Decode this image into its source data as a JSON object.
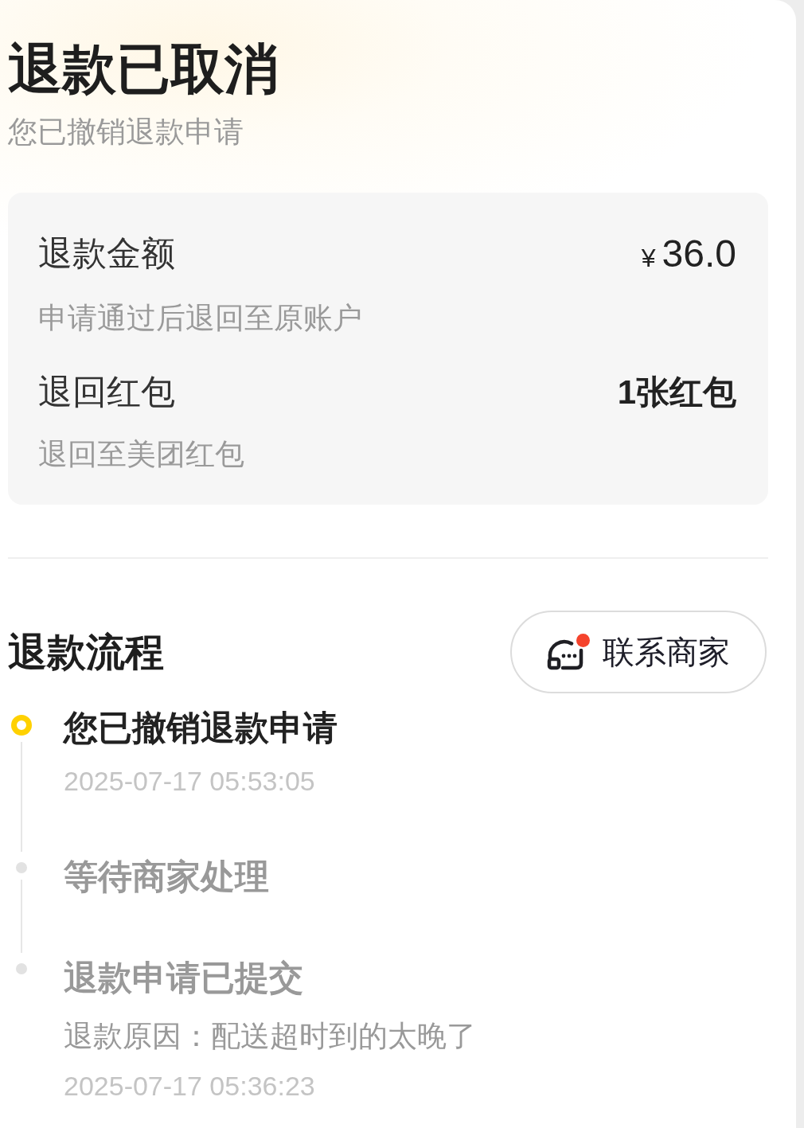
{
  "header": {
    "title": "退款已取消",
    "subtitle": "您已撤销退款申请"
  },
  "refund_summary": {
    "rows": [
      {
        "kind": "amount",
        "label": "退款金额",
        "currency": "¥",
        "value": "36.0",
        "note": "申请通过后退回至原账户"
      },
      {
        "kind": "count",
        "label": "退回红包",
        "value": "1张红包",
        "note": "退回至美团红包"
      }
    ]
  },
  "process": {
    "title": "退款流程",
    "contact_button": {
      "label": "联系商家"
    },
    "steps": [
      {
        "title": "您已撤销退款申请",
        "time": "2025-07-17 05:53:05",
        "active": true
      },
      {
        "title": "等待商家处理",
        "active": false
      },
      {
        "title": "退款申请已提交",
        "reason": "退款原因：配送超时到的太晚了",
        "time": "2025-07-17 05:36:23",
        "active": false
      }
    ]
  }
}
